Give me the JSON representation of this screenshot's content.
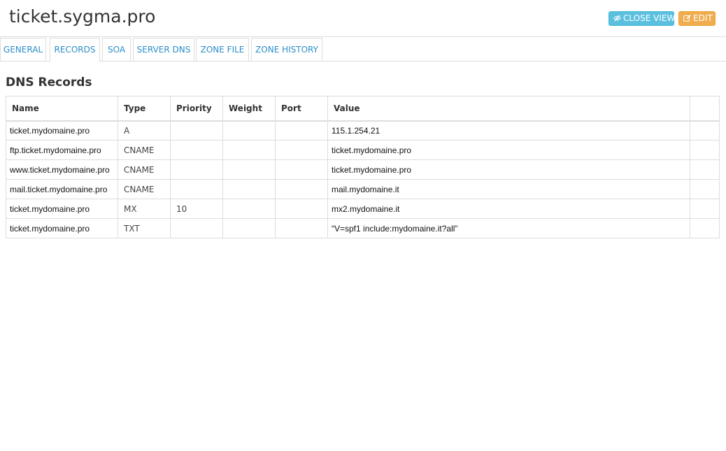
{
  "header": {
    "title": "ticket.sygma.pro",
    "close_view_label": "CLOSE VIEW",
    "edit_label": "EDIT"
  },
  "colors": {
    "close_view_bg": "#5bc0de",
    "edit_bg": "#f0ad4e",
    "tab_link": "#2a8ec9"
  },
  "tabs": [
    {
      "label": "GENERAL",
      "active": false
    },
    {
      "label": "RECORDS",
      "active": true
    },
    {
      "label": "SOA",
      "active": false
    },
    {
      "label": "SERVER DNS",
      "active": false
    },
    {
      "label": "ZONE FILE",
      "active": false
    },
    {
      "label": "ZONE HISTORY",
      "active": false
    }
  ],
  "section": {
    "title": "DNS Records"
  },
  "table": {
    "columns": [
      "Name",
      "Type",
      "Priority",
      "Weight",
      "Port",
      "Value",
      ""
    ],
    "rows": [
      {
        "name": "ticket.mydomaine.pro",
        "type": "A",
        "priority": "",
        "weight": "",
        "port": "",
        "value": "115.1.254.21"
      },
      {
        "name": "ftp.ticket.mydomaine.pro",
        "type": "CNAME",
        "priority": "",
        "weight": "",
        "port": "",
        "value": "ticket.mydomaine.pro"
      },
      {
        "name": "www.ticket.mydomaine.pro",
        "type": "CNAME",
        "priority": "",
        "weight": "",
        "port": "",
        "value": "ticket.mydomaine.pro"
      },
      {
        "name": "mail.ticket.mydomaine.pro",
        "type": "CNAME",
        "priority": "",
        "weight": "",
        "port": "",
        "value": "mail.mydomaine.it"
      },
      {
        "name": "ticket.mydomaine.pro",
        "type": "MX",
        "priority": "10",
        "weight": "",
        "port": "",
        "value": "mx2.mydomaine.it"
      },
      {
        "name": "ticket.mydomaine.pro",
        "type": "TXT",
        "priority": "",
        "weight": "",
        "port": "",
        "value": "“V=spf1 include:mydomaine.it?all”"
      }
    ]
  }
}
